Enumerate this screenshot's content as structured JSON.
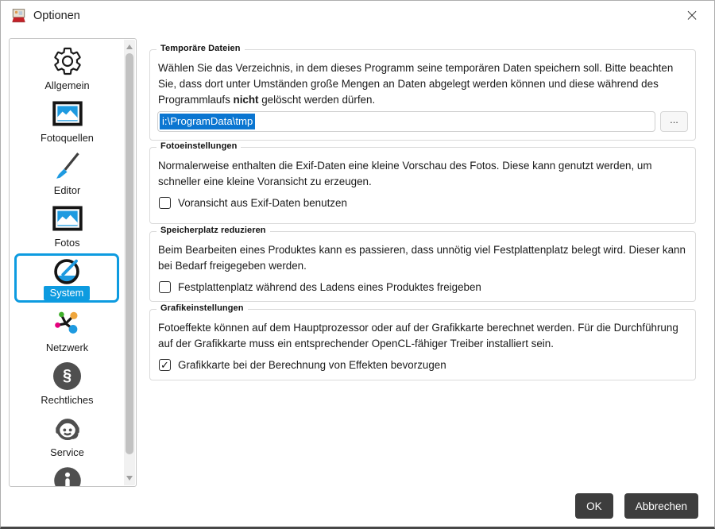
{
  "window": {
    "title": "Optionen",
    "close_glyph": "×"
  },
  "sidebar": {
    "items": [
      {
        "label": "Allgemein"
      },
      {
        "label": "Fotoquellen"
      },
      {
        "label": "Editor"
      },
      {
        "label": "Fotos"
      },
      {
        "label": "System"
      },
      {
        "label": "Netzwerk"
      },
      {
        "label": "Rechtliches"
      },
      {
        "label": "Service"
      },
      {
        "label": ""
      }
    ],
    "selected": "System",
    "paragraph_glyph": "§"
  },
  "groups": {
    "temp": {
      "title": "Temporäre Dateien",
      "text_1": "Wählen Sie das Verzeichnis, in dem dieses Programm seine temporären Daten speichern soll. Bitte beachten Sie, dass dort unter Umständen große Mengen an Daten abgelegt werden können und diese während des Programmlaufs ",
      "bold_word": "nicht",
      "text_2": " gelöscht werden dürfen.",
      "path_value": "i:\\ProgramData\\tmp",
      "browse_label": "..."
    },
    "foto": {
      "title": "Fotoeinstellungen",
      "text": "Normalerweise enthalten die Exif-Daten eine kleine Vorschau des Fotos. Diese kann genutzt werden, um schneller eine kleine Voransicht zu erzeugen.",
      "checkbox_label": "Voransicht aus Exif-Daten benutzen",
      "checkbox_glyph": ""
    },
    "speicher": {
      "title": "Speicherplatz reduzieren",
      "text": "Beim Bearbeiten eines Produktes kann es passieren, dass unnötig viel Festplattenplatz belegt wird. Dieser kann bei Bedarf freigegeben werden.",
      "checkbox_label": "Festplattenplatz während des Ladens eines Produktes freigeben",
      "checkbox_glyph": ""
    },
    "grafik": {
      "title": "Grafikeinstellungen",
      "text": "Fotoeffekte können auf dem Hauptprozessor oder auf der Grafikkarte berechnet werden. Für die Durchführung auf der Grafikkarte muss ein entsprechender OpenCL-fähiger Treiber installiert sein.",
      "checkbox_label": "Grafikkarte bei der Berechnung von Effekten bevorzugen",
      "checkbox_glyph": "✓"
    }
  },
  "footer": {
    "ok_label": "OK",
    "cancel_label": "Abbrechen"
  },
  "colors": {
    "accent_blue": "#0d9be0",
    "selection_blue": "#0b76d1",
    "button_dark": "#3d3d3d",
    "icon_dark": "#1a1a1a",
    "icon_gray": "#4f4f4f"
  }
}
